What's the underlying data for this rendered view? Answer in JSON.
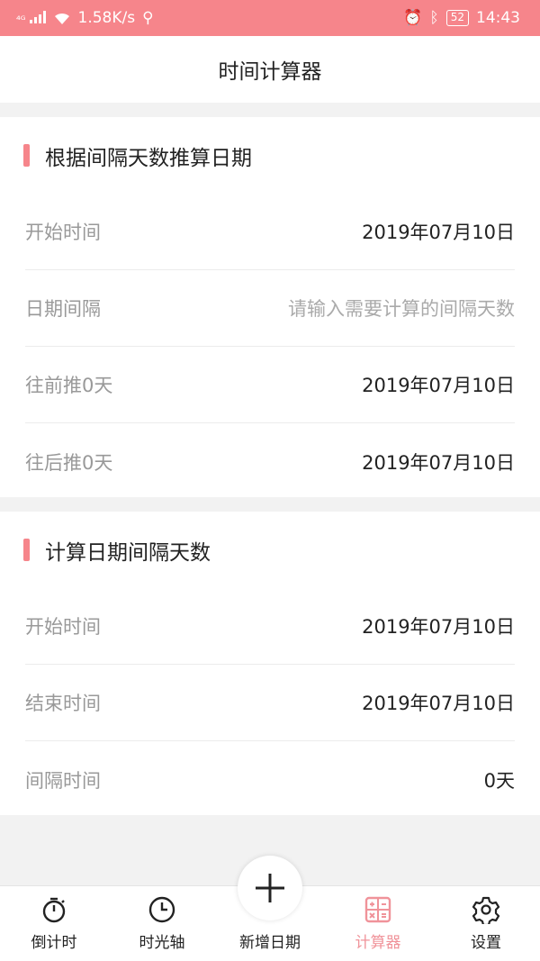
{
  "status": {
    "network": "⁴ᴳ",
    "speed": "1.58K/s",
    "battery": "52",
    "time": "14:43"
  },
  "header": {
    "title": "时间计算器"
  },
  "section1": {
    "title": "根据间隔天数推算日期",
    "rows": [
      {
        "label": "开始时间",
        "value": "2019年07月10日"
      },
      {
        "label": "日期间隔",
        "placeholder": "请输入需要计算的间隔天数"
      },
      {
        "label": "往前推0天",
        "value": "2019年07月10日"
      },
      {
        "label": "往后推0天",
        "value": "2019年07月10日"
      }
    ]
  },
  "section2": {
    "title": "计算日期间隔天数",
    "rows": [
      {
        "label": "开始时间",
        "value": "2019年07月10日"
      },
      {
        "label": "结束时间",
        "value": "2019年07月10日"
      },
      {
        "label": "间隔时间",
        "value": "0天"
      }
    ]
  },
  "tabs": [
    {
      "label": "倒计时",
      "icon": "stopwatch-icon"
    },
    {
      "label": "时光轴",
      "icon": "clock-icon"
    },
    {
      "label": "新增日期",
      "icon": "plus-icon"
    },
    {
      "label": "计算器",
      "icon": "calculator-icon",
      "active": true
    },
    {
      "label": "设置",
      "icon": "gear-icon"
    }
  ],
  "colors": {
    "accent": "#f6858b",
    "active_tab": "#f0939a"
  }
}
